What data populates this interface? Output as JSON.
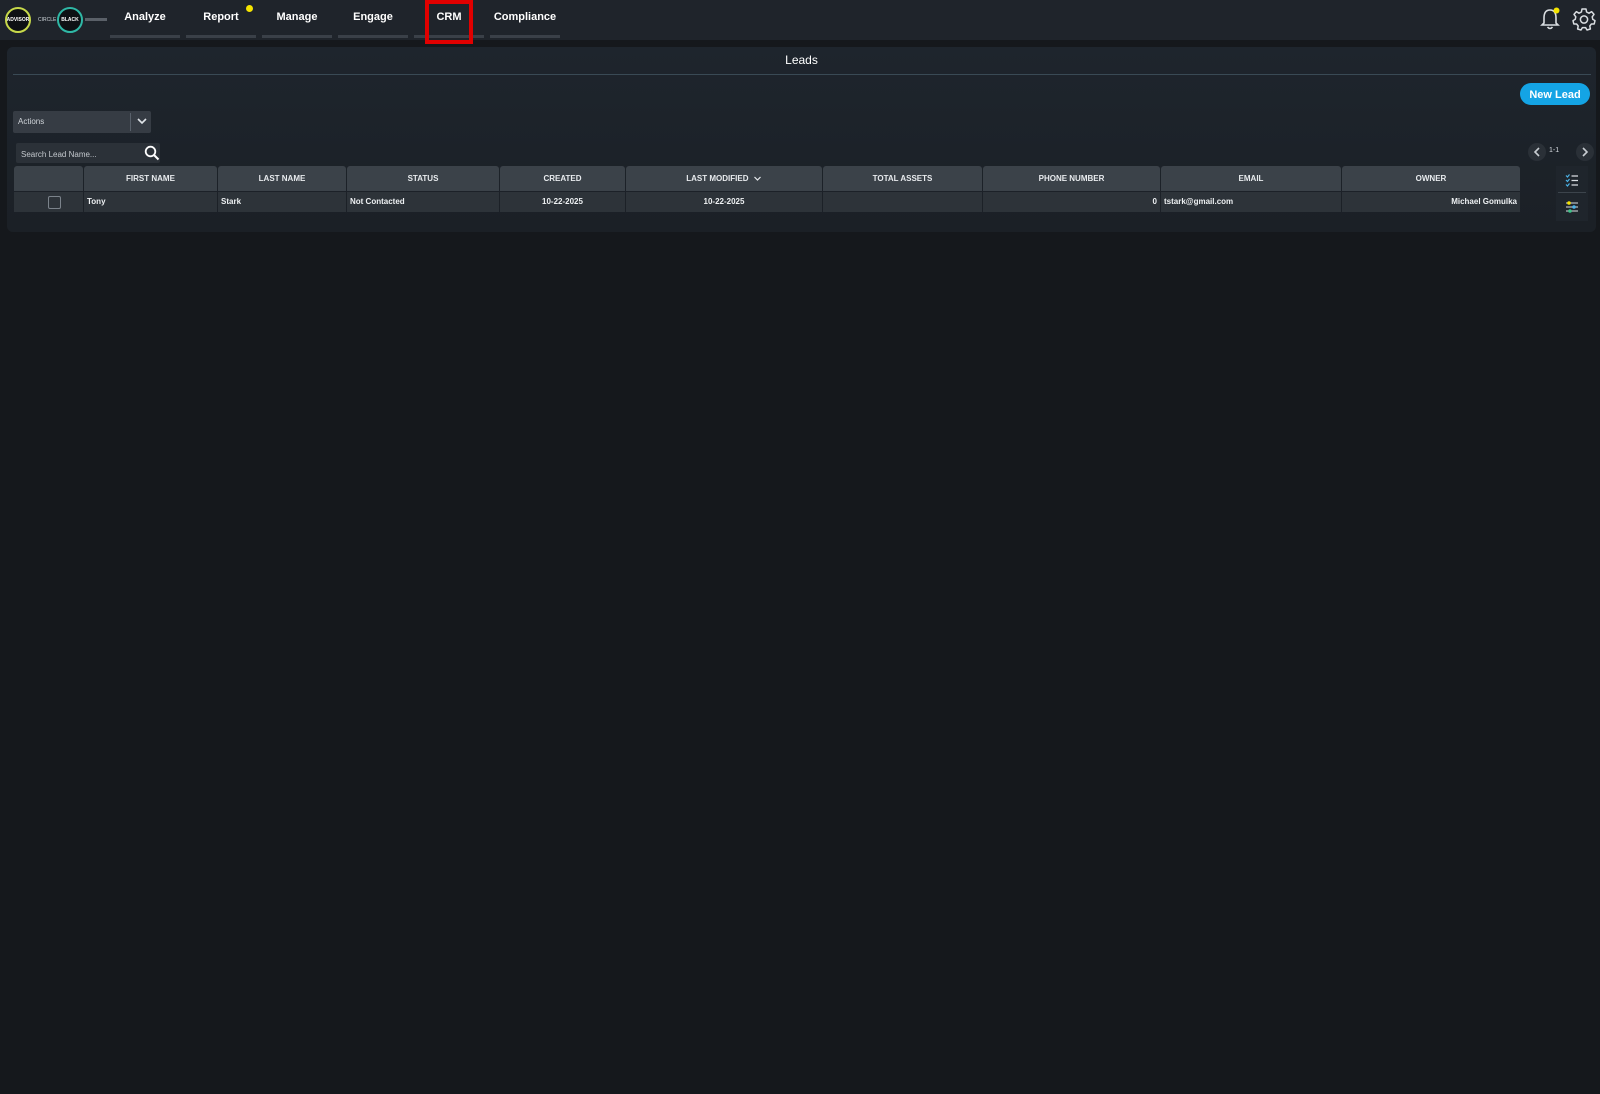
{
  "nav": {
    "logo_left": "ADVISOR",
    "logo_mid": "CIRCLE",
    "logo_right": "BLACK",
    "items": [
      {
        "label": "Analyze"
      },
      {
        "label": "Report"
      },
      {
        "label": "Manage"
      },
      {
        "label": "Engage"
      },
      {
        "label": "CRM"
      },
      {
        "label": "Compliance"
      }
    ],
    "active": "CRM",
    "indicator_color": "#f5e400",
    "highlight_color": "#e10000"
  },
  "panel": {
    "title": "Leads",
    "new_lead_label": "New Lead",
    "actions_label": "Actions",
    "search_placeholder": "Search Lead Name...",
    "pager_text": "1-1"
  },
  "table": {
    "columns": [
      "FIRST NAME",
      "LAST NAME",
      "STATUS",
      "CREATED",
      "LAST MODIFIED",
      "TOTAL ASSETS",
      "PHONE NUMBER",
      "EMAIL",
      "OWNER"
    ],
    "sorted_column": "LAST MODIFIED",
    "rows": [
      {
        "first_name": "Tony",
        "last_name": "Stark",
        "status": "Not Contacted",
        "created": "10-22-2025",
        "last_modified": "10-22-2025",
        "total_assets": "",
        "phone_number": "0",
        "email": "tstark@gmail.com",
        "owner": "Michael Gomulka"
      }
    ]
  },
  "icons": {
    "bell": "bell-icon",
    "settings": "gear-icon",
    "search": "search-icon",
    "column_chooser": "checklist-icon",
    "filter_settings": "sliders-icon"
  },
  "colors": {
    "accent": "#14a4e5",
    "background": "#15181c"
  }
}
